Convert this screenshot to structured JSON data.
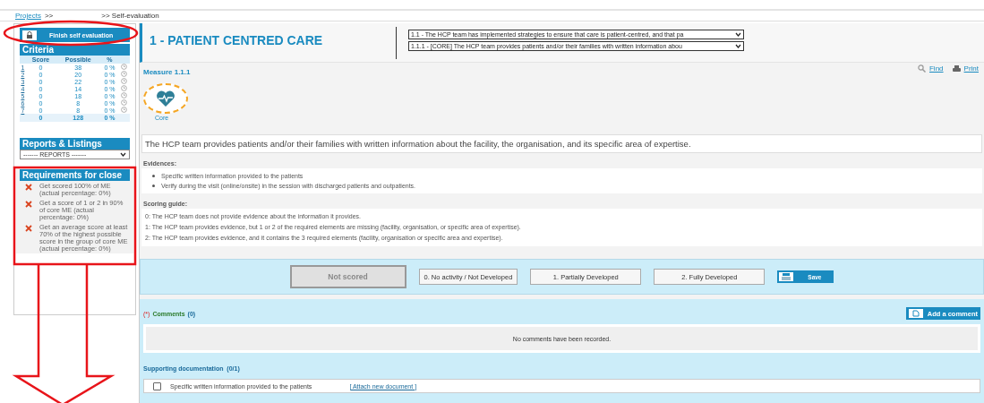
{
  "breadcrumb": {
    "link": "Projects",
    "separator": ">>",
    "current": ">> Self-evaluation"
  },
  "sidebar": {
    "finish_button": "Finish self evaluation",
    "criteria": {
      "title": "Criteria",
      "columns": [
        "Score",
        "Possible",
        "%"
      ],
      "rows": [
        {
          "number": "1",
          "score": "0",
          "possible": "38",
          "percent": "0 %"
        },
        {
          "number": "2",
          "score": "0",
          "possible": "20",
          "percent": "0 %"
        },
        {
          "number": "3",
          "score": "0",
          "possible": "22",
          "percent": "0 %"
        },
        {
          "number": "4",
          "score": "0",
          "possible": "14",
          "percent": "0 %"
        },
        {
          "number": "5",
          "score": "0",
          "possible": "18",
          "percent": "0 %"
        },
        {
          "number": "6",
          "score": "0",
          "possible": "8",
          "percent": "0 %"
        },
        {
          "number": "7",
          "score": "0",
          "possible": "8",
          "percent": "0 %"
        }
      ],
      "total": {
        "score": "0",
        "possible": "128",
        "percent": "0 %"
      }
    },
    "reports": {
      "title": "Reports & Listings",
      "select": "------- REPORTS -------"
    },
    "requirements": {
      "title": "Requirements for close",
      "items": [
        {
          "text": "Get scored 100% of ME (actual percentage: 0%)",
          "met": false
        },
        {
          "text": "Get a score of 1 or 2 in 90% of core ME (actual percentage: 0%)",
          "met": false
        },
        {
          "text": "Get an average score at least 70% of the highest possible score in the group of core ME (actual percentage: 0%)",
          "met": false
        }
      ]
    }
  },
  "section": {
    "title": "1 - PATIENT CENTRED CARE",
    "selects": [
      "1.1 - The HCP team has implemented strategies to ensure that care is patient-centred, and that pa",
      "1.1.1 - [CORE] The HCP team provides patients and/or their families with written information abou"
    ]
  },
  "measure": {
    "title": "Measure 1.1.1",
    "badge": "Core",
    "find": "Find",
    "print": "Print",
    "description": "The HCP team provides patients and/or their families with written information about the facility, the organisation, and its specific area of expertise."
  },
  "evidences": {
    "label": "Evidences:",
    "items": [
      "Specific written information provided to the patients",
      "Verify during the visit (online/onsite) in the session with discharged patients and outpatients."
    ]
  },
  "scoring_guide": {
    "label": "Scoring guide:",
    "lines": [
      "0: The HCP team does not provide evidence about the information it provides.",
      "1: The HCP team provides evidence, but 1 or 2 of the required elements are missing (facility, organisation, or specific area of expertise).",
      "2: The HCP team provides evidence, and it contains the 3 required elements (facility, organisation or specific area and expertise)."
    ]
  },
  "score_buttons": [
    {
      "label": "Not scored",
      "selected": true
    },
    {
      "label": "0. No activity / Not Developed",
      "selected": false
    },
    {
      "label": "1. Partially Developed",
      "selected": false
    },
    {
      "label": "2. Fully Developed",
      "selected": false
    }
  ],
  "save_button": "Save",
  "comments": {
    "required_mark": "(*)",
    "label": "Comments",
    "count": "(0)",
    "add_button": "Add a comment",
    "empty": "No comments have been recorded."
  },
  "documentation": {
    "label": "Supporting documentation",
    "count": "(0/1)",
    "items": [
      {
        "text": "Specific written information provided to the patients",
        "checked": false,
        "link": "[ Attach new document ]"
      }
    ]
  },
  "annotations": [
    {
      "kind": "ellipse"
    },
    {
      "kind": "rectangle"
    },
    {
      "kind": "arrow"
    }
  ]
}
